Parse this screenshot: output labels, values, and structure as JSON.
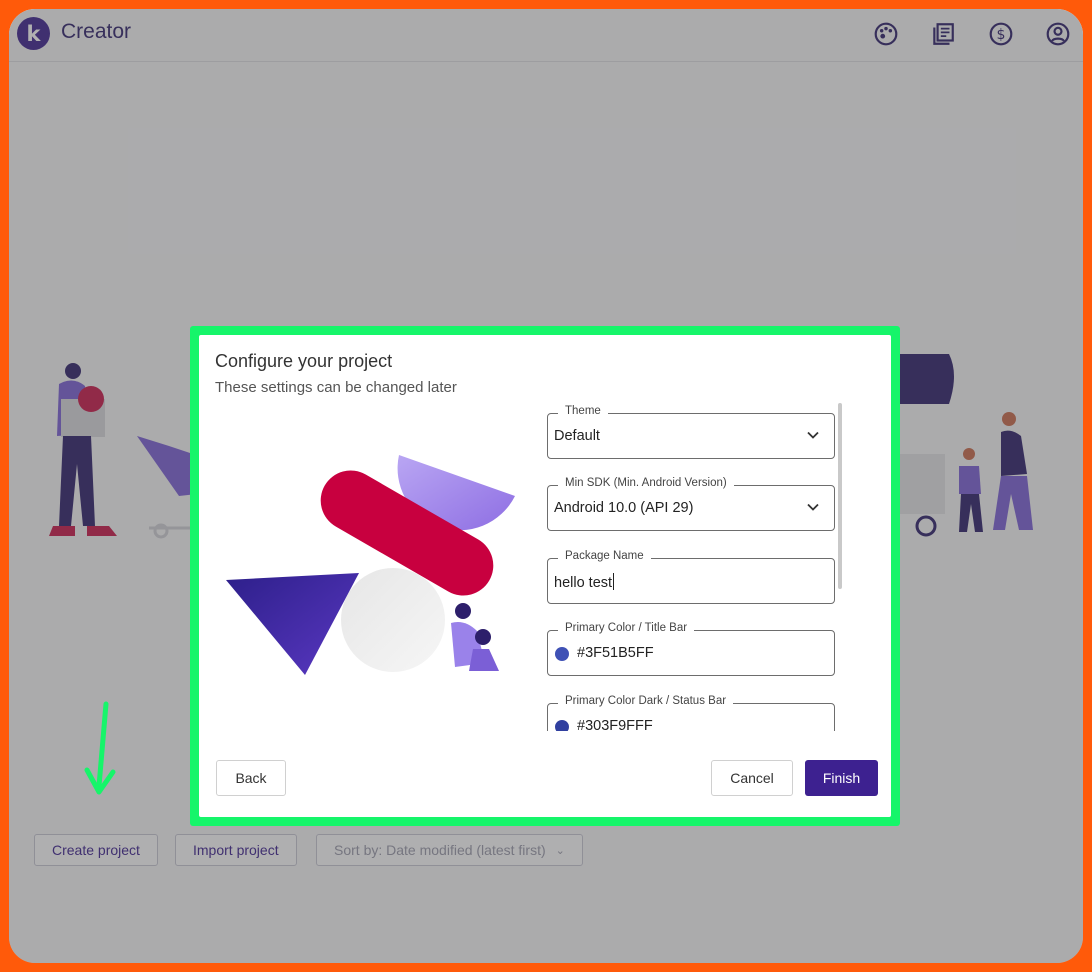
{
  "app": {
    "title": "Creator",
    "logo_letter": "k"
  },
  "header": {
    "icons": [
      "palette-icon",
      "docs-icon",
      "dollar-icon",
      "account-icon"
    ]
  },
  "toolbar": {
    "create_label": "Create project",
    "import_label": "Import project",
    "sort_label": "Sort by: Date modified (latest first)"
  },
  "dialog": {
    "title": "Configure your project",
    "subtitle": "These settings can be changed later",
    "fields": [
      {
        "label": "Theme",
        "value": "Default",
        "kind": "select"
      },
      {
        "label": "Min SDK (Min. Android Version)",
        "value": "Android 10.0 (API 29)",
        "kind": "select"
      },
      {
        "label": "Package Name",
        "value": "hello test",
        "kind": "text"
      },
      {
        "label": "Primary Color / Title Bar",
        "value": "#3F51B5FF",
        "kind": "color",
        "swatch": "#3F51B5"
      },
      {
        "label": "Primary Color Dark / Status Bar",
        "value": "#303F9FFF",
        "kind": "color",
        "swatch": "#303F9F"
      }
    ],
    "back_label": "Back",
    "cancel_label": "Cancel",
    "finish_label": "Finish"
  },
  "colors": {
    "accent": "#3D2190",
    "highlight_border": "#16F56A",
    "frame_border": "#FF5A0A"
  }
}
